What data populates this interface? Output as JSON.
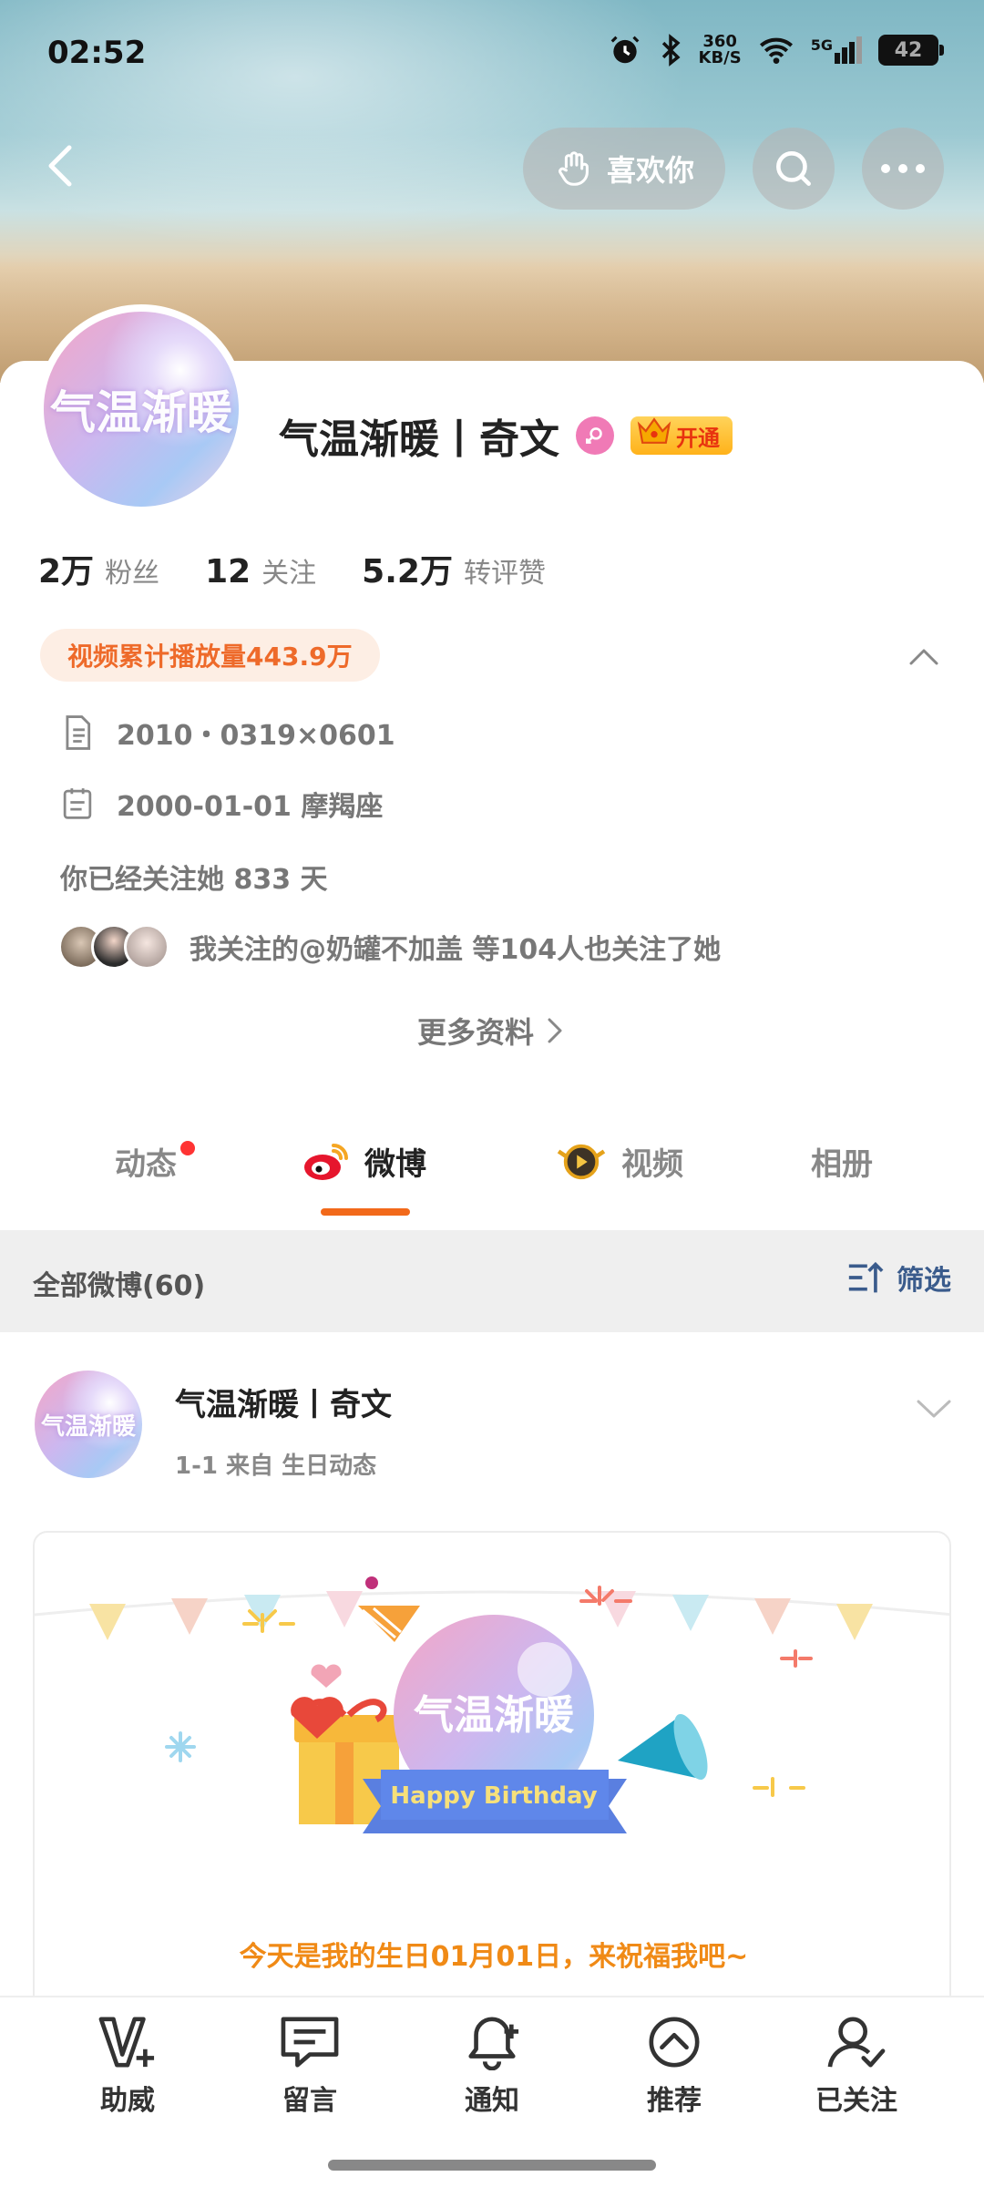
{
  "status_bar": {
    "time": "02:52",
    "net_speed_top": "360",
    "net_speed_bottom": "KB/S",
    "signal_label": "5G",
    "battery": "42"
  },
  "top_nav": {
    "like_label": "喜欢你"
  },
  "profile": {
    "avatar_text": "气温渐暖",
    "name": "气温渐暖丨奇文",
    "vip_label": "开通",
    "stats": [
      {
        "num": "2万",
        "label": "粉丝"
      },
      {
        "num": "12",
        "label": "关注"
      },
      {
        "num": "5.2万",
        "label": "转评赞"
      }
    ],
    "play_count": "视频累计播放量443.9万",
    "info_id": "2010・0319×0601",
    "info_birthday": "2000-01-01 摩羯座",
    "follow_days": "你已经关注她 833 天",
    "mutual": "我关注的@奶罐不加盖 等104人也关注了她",
    "more_info": "更多资料"
  },
  "tabs": [
    {
      "label": "动态"
    },
    {
      "label": "微博"
    },
    {
      "label": "视频"
    },
    {
      "label": "相册"
    }
  ],
  "filter": {
    "label": "全部微博(60)",
    "button": "筛选"
  },
  "post": {
    "name": "气温渐暖丨奇文",
    "meta": "1-1   来自 生日动态",
    "banner_text": "Happy Birthday",
    "birthday_message": "今天是我的生日01月01日，来祝福我吧~"
  },
  "bottom_bar": [
    {
      "label": "助威",
      "icon": "cheer-icon"
    },
    {
      "label": "留言",
      "icon": "message-icon"
    },
    {
      "label": "通知",
      "icon": "bell-icon"
    },
    {
      "label": "推荐",
      "icon": "recommend-icon"
    },
    {
      "label": "已关注",
      "icon": "followed-icon"
    }
  ],
  "colors": {
    "accent": "#f2691a",
    "filter_blue": "#3a5b8c",
    "birthday_orange": "#f08a16"
  }
}
